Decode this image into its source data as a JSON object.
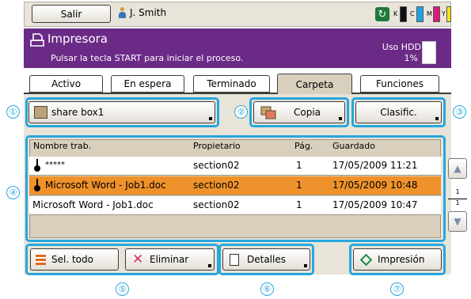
{
  "topbar": {
    "logout_label": "Salir",
    "user_name": "J. Smith",
    "toner": [
      {
        "letter": "K",
        "color": "#111111"
      },
      {
        "letter": "C",
        "color": "#1aa5e0"
      },
      {
        "letter": "M",
        "color": "#d81b7b"
      },
      {
        "letter": "Y",
        "color": "#f4e21a"
      }
    ]
  },
  "header": {
    "title": "Impresora",
    "subtitle": "Pulsar la tecla START para iniciar el proceso.",
    "hdd_label": "Uso HDD",
    "hdd_percent": "1%"
  },
  "tabs": [
    {
      "label": "Activo",
      "active": false
    },
    {
      "label": "En espera",
      "active": false
    },
    {
      "label": "Terminado",
      "active": false
    },
    {
      "label": "Carpeta",
      "active": true
    },
    {
      "label": "Funciones",
      "active": false
    }
  ],
  "folder_bar": {
    "box_label": "share box1",
    "copy_label": "Copia",
    "sort_label": "Clasific."
  },
  "table": {
    "headers": [
      "Nombre trab.",
      "Propietario",
      "Pág.",
      "Guardado"
    ],
    "rows": [
      {
        "name": "*****",
        "owner": "section02",
        "pages": "1",
        "saved": "17/05/2009 11:21",
        "locked": true,
        "selected": false
      },
      {
        "name": "Microsoft Word - Job1.doc",
        "owner": "section02",
        "pages": "1",
        "saved": "17/05/2009 10:48",
        "locked": true,
        "selected": true
      },
      {
        "name": "Microsoft Word - Job1.doc",
        "owner": "section02",
        "pages": "1",
        "saved": "17/05/2009 10:47",
        "locked": false,
        "selected": false
      }
    ],
    "page_current": "1",
    "page_total": "1"
  },
  "actions": {
    "select_all": "Sel. todo",
    "delete": "Eliminar",
    "details": "Detalles",
    "print": "Impresión"
  },
  "callouts": [
    "①",
    "②",
    "③",
    "④",
    "⑤",
    "⑥",
    "⑦"
  ],
  "colors": {
    "header_purple": "#6b2a86",
    "highlight_blue": "#27a7dc",
    "selected_row": "#f0922b",
    "panel_bg": "#e9e4da"
  }
}
